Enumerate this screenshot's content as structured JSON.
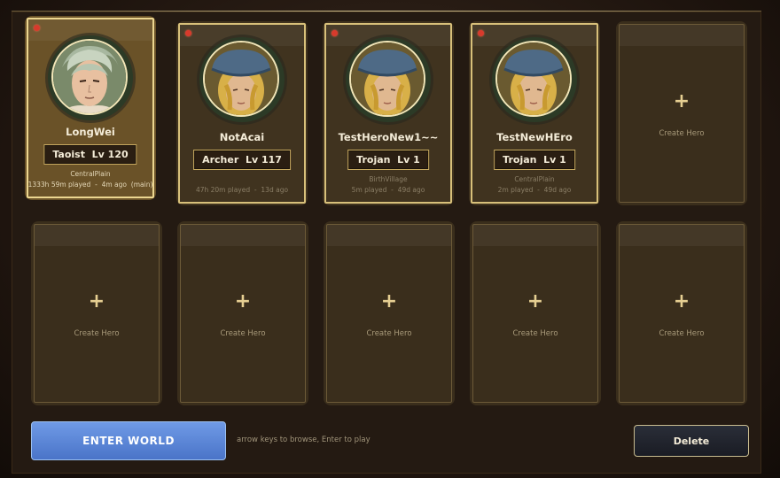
{
  "heroes": [
    {
      "name": "LongWei",
      "class": "Taoist",
      "level": "Lv 120",
      "map": "CentralPlain",
      "played": "1333h 59m played",
      "ago": "4m ago",
      "tag": "(main)",
      "selected": true,
      "portrait": "taoist-portrait"
    },
    {
      "name": "NotAcai",
      "class": "Archer",
      "level": "Lv 117",
      "map": "",
      "played": "47h 20m played",
      "ago": "13d ago",
      "tag": "",
      "selected": false,
      "portrait": "capped-hero-portrait"
    },
    {
      "name": "TestHeroNew1~~",
      "class": "Trojan",
      "level": "Lv 1",
      "map": "BirthVillage",
      "played": "5m played",
      "ago": "49d ago",
      "tag": "",
      "selected": false,
      "portrait": "capped-hero-portrait"
    },
    {
      "name": "TestNewHEro",
      "class": "Trojan",
      "level": "Lv 1",
      "map": "CentralPlain",
      "played": "2m played",
      "ago": "49d ago",
      "tag": "",
      "selected": false,
      "portrait": "capped-hero-portrait"
    }
  ],
  "empty_slot": {
    "plus": "+",
    "label": "Create Hero"
  },
  "separator": "-",
  "footer": {
    "enter_label": "ENTER  WORLD",
    "hint": "arrow keys to browse, Enter to play",
    "delete_label": "Delete"
  },
  "colors": {
    "status_dot": "#d83a2c",
    "enter_button": "#5a86d8",
    "frame_gold": "#d8c07a"
  }
}
